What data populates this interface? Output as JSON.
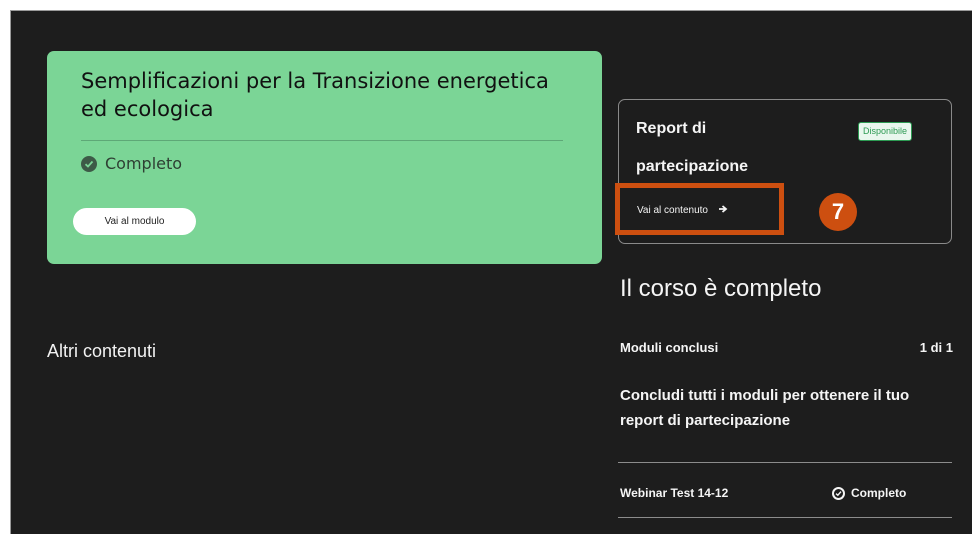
{
  "module": {
    "title": "Semplificazioni per la Transizione energetica ed ecologica",
    "status": "Completo",
    "button_label": "Vai al modulo",
    "card_color": "#7bd596"
  },
  "other": {
    "heading": "Altri contenuti"
  },
  "report": {
    "title": "Report di partecipazione",
    "badge": "Disponibile",
    "link_label": "Vai al contenuto",
    "link_icon": "arrow-right-icon"
  },
  "annotation": {
    "marker_number": "7",
    "color": "#cd4f10"
  },
  "course": {
    "heading": "Il corso è completo",
    "modules_label": "Moduli conclusi",
    "modules_count": "1 di 1",
    "instruction": "Concludi tutti i moduli per ottenere il tuo report di partecipazione",
    "items": [
      {
        "name": "Webinar Test 14-12",
        "status": "Completo"
      }
    ]
  }
}
